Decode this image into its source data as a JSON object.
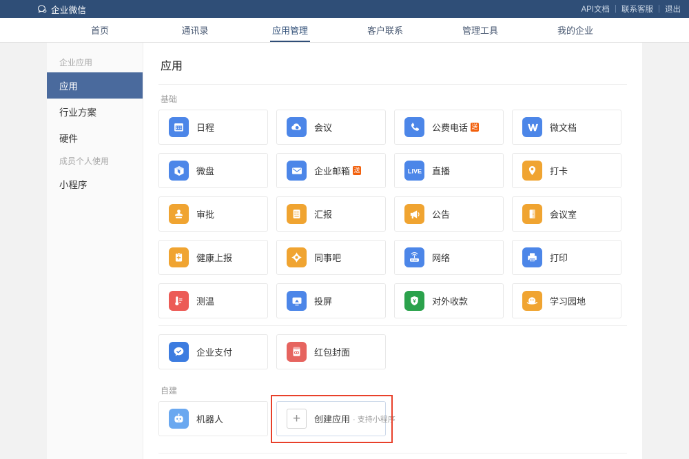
{
  "topbar": {
    "brand": "企业微信",
    "logo_icon": "speech-bubble-logo",
    "links": [
      {
        "label": "API文档"
      },
      {
        "label": "联系客服"
      },
      {
        "label": "退出"
      }
    ],
    "separator": "|",
    "background": "#2f4e77"
  },
  "nav": {
    "items": [
      {
        "label": "首页",
        "active": false
      },
      {
        "label": "通讯录",
        "active": false
      },
      {
        "label": "应用管理",
        "active": true
      },
      {
        "label": "客户联系",
        "active": false
      },
      {
        "label": "管理工具",
        "active": false
      },
      {
        "label": "我的企业",
        "active": false
      }
    ],
    "active_color": "#2f4e77"
  },
  "sidebar": {
    "groups": [
      {
        "label": "企业应用",
        "items": [
          {
            "label": "应用",
            "active": true
          },
          {
            "label": "行业方案",
            "active": false
          },
          {
            "label": "硬件",
            "active": false
          }
        ]
      },
      {
        "label": "成员个人使用",
        "items": [
          {
            "label": "小程序",
            "active": false
          }
        ]
      }
    ],
    "active_background": "#4a6a9d"
  },
  "main": {
    "title": "应用",
    "sections": [
      {
        "label": "基础",
        "apps": [
          {
            "label": "日程",
            "icon": "calendar-icon",
            "color": "#4c86e8",
            "badge": null
          },
          {
            "label": "会议",
            "icon": "meeting-cloud-icon",
            "color": "#4c86e8",
            "badge": null
          },
          {
            "label": "公费电话",
            "icon": "phone-icon",
            "color": "#4c86e8",
            "badge": "送"
          },
          {
            "label": "微文档",
            "icon": "wedoc-w-icon",
            "color": "#4c86e8",
            "badge": null
          },
          {
            "label": "微盘",
            "icon": "drive-box-icon",
            "color": "#4c86e8",
            "badge": null
          },
          {
            "label": "企业邮箱",
            "icon": "mail-envelope-icon",
            "color": "#4c86e8",
            "badge": "送"
          },
          {
            "label": "直播",
            "icon": "live-text-icon",
            "color": "#4c86e8",
            "badge": null
          },
          {
            "label": "打卡",
            "icon": "location-pin-icon",
            "color": "#f0a431",
            "badge": null
          },
          {
            "label": "审批",
            "icon": "stamp-icon",
            "color": "#f0a431",
            "badge": null
          },
          {
            "label": "汇报",
            "icon": "report-doc-icon",
            "color": "#f0a431",
            "badge": null
          },
          {
            "label": "公告",
            "icon": "megaphone-icon",
            "color": "#f0a431",
            "badge": null
          },
          {
            "label": "会议室",
            "icon": "door-icon",
            "color": "#f0a431",
            "badge": null
          },
          {
            "label": "健康上报",
            "icon": "clipboard-plus-icon",
            "color": "#f0a431",
            "badge": null
          },
          {
            "label": "同事吧",
            "icon": "diamond-icon",
            "color": "#f0a431",
            "badge": null
          },
          {
            "label": "网络",
            "icon": "router-wifi-icon",
            "color": "#4c86e8",
            "badge": null
          },
          {
            "label": "打印",
            "icon": "printer-icon",
            "color": "#4c86e8",
            "badge": null
          },
          {
            "label": "测温",
            "icon": "thermometer-icon",
            "color": "#ec5b56",
            "badge": null
          },
          {
            "label": "投屏",
            "icon": "screen-cast-icon",
            "color": "#4c86e8",
            "badge": null
          },
          {
            "label": "对外收款",
            "icon": "shield-yuan-icon",
            "color": "#2ba24c",
            "badge": null
          },
          {
            "label": "学习园地",
            "icon": "study-planet-icon",
            "color": "#f0a431",
            "badge": null
          }
        ]
      },
      {
        "label": "",
        "apps": [
          {
            "label": "企业支付",
            "icon": "pay-check-bubble-icon",
            "color": "#3c7ce0",
            "badge": null
          },
          {
            "label": "红包封面",
            "icon": "red-packet-icon",
            "color": "#e6645f",
            "badge": null
          }
        ]
      }
    ],
    "custom_section": {
      "label": "自建",
      "apps": [
        {
          "label": "机器人",
          "icon": "robot-icon",
          "color": "#6aa8f0",
          "badge": null
        }
      ],
      "create": {
        "icon": "plus-icon",
        "plus_glyph": "+",
        "label": "创建应用",
        "sub_label": "· 支持小程序",
        "highlight_color": "#e8402a"
      }
    }
  }
}
